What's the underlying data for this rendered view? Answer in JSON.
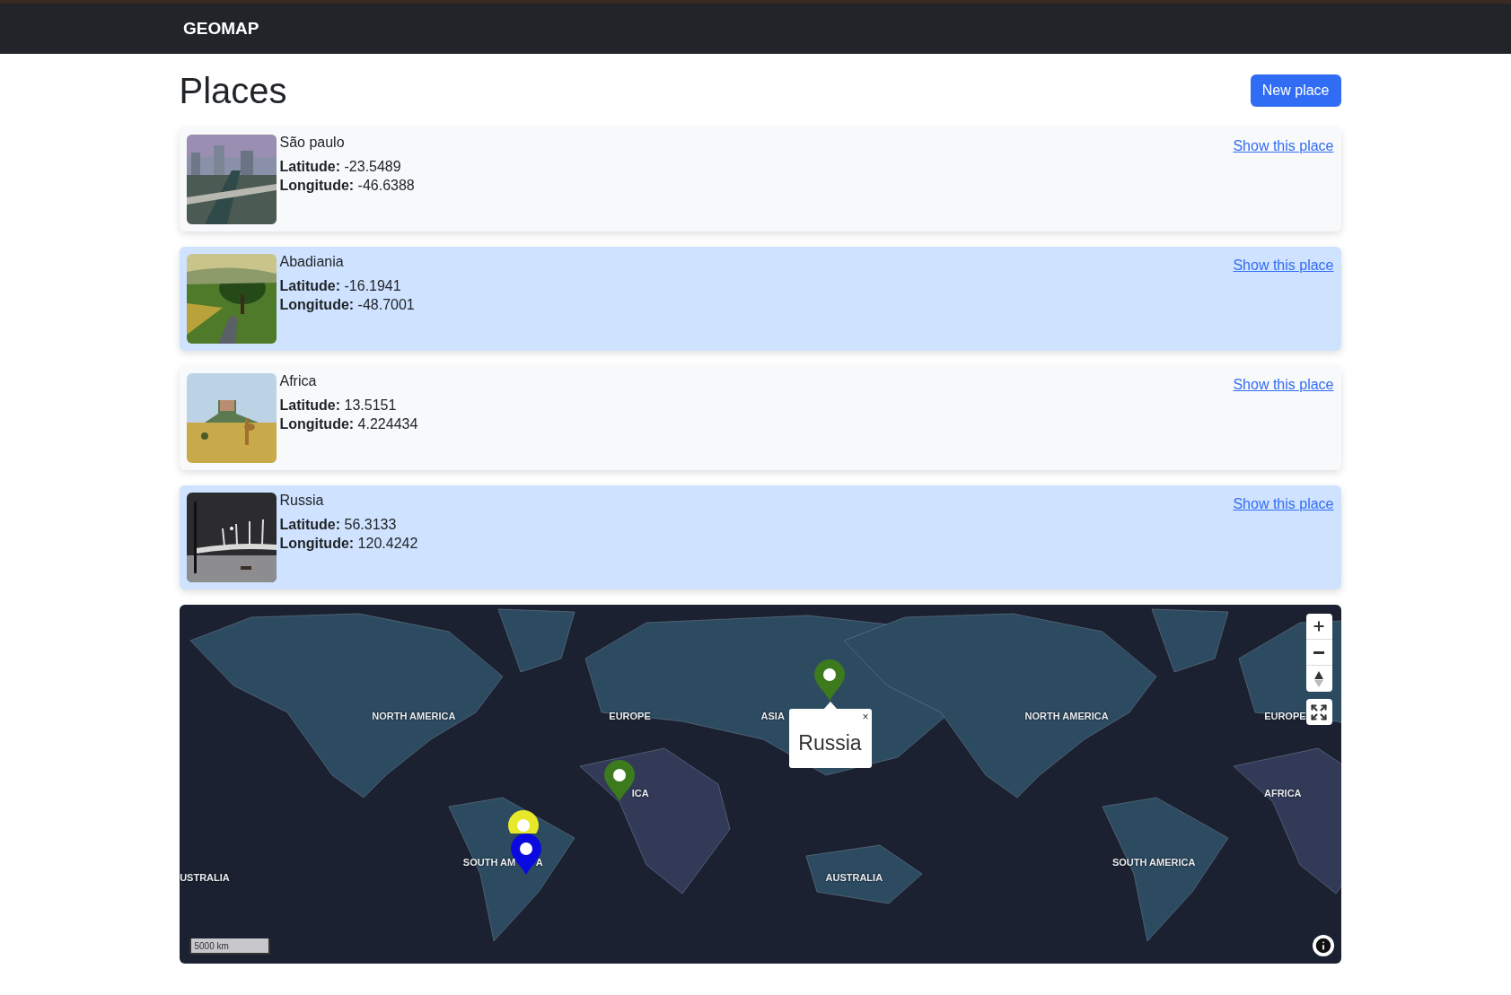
{
  "navbar": {
    "brand": "GEOMAP"
  },
  "header": {
    "title": "Places",
    "button": "New place"
  },
  "places": [
    {
      "name": "São paulo",
      "lat_label": "Latitude:",
      "lat": "-23.5489",
      "lon_label": "Longitude:",
      "lon": "-46.6388",
      "link": "Show this place",
      "highlighted": false
    },
    {
      "name": "Abadiania",
      "lat_label": "Latitude:",
      "lat": "-16.1941",
      "lon_label": "Longitude:",
      "lon": "-48.7001",
      "link": "Show this place",
      "highlighted": true
    },
    {
      "name": "Africa",
      "lat_label": "Latitude:",
      "lat": "13.5151",
      "lon_label": "Longitude:",
      "lon": "4.224434",
      "link": "Show this place",
      "highlighted": false
    },
    {
      "name": "Russia",
      "lat_label": "Latitude:",
      "lat": "56.3133",
      "lon_label": "Longitude:",
      "lon": "120.4242",
      "link": "Show this place",
      "highlighted": true
    }
  ],
  "map": {
    "labels": [
      {
        "text": "NORTH AMERICA"
      },
      {
        "text": "EUROPE"
      },
      {
        "text": "ASIA"
      },
      {
        "text": "NORTH AMERICA"
      },
      {
        "text": "EUROPE"
      },
      {
        "text": "ICA"
      },
      {
        "text": "AFRICA"
      },
      {
        "text": "SOUTH AM"
      },
      {
        "text": "A"
      },
      {
        "text": "SOUTH AMERICA"
      },
      {
        "text": "USTRALIA"
      },
      {
        "text": "AUSTRALIA"
      }
    ],
    "markers": [
      {
        "color": "#3d7a1e"
      },
      {
        "color": "#3d7a1e"
      },
      {
        "color": "#e8e82a"
      },
      {
        "color": "#0a0ae0"
      }
    ],
    "popup": {
      "title": "Russia",
      "close": "×"
    },
    "scale": "5000 km"
  }
}
